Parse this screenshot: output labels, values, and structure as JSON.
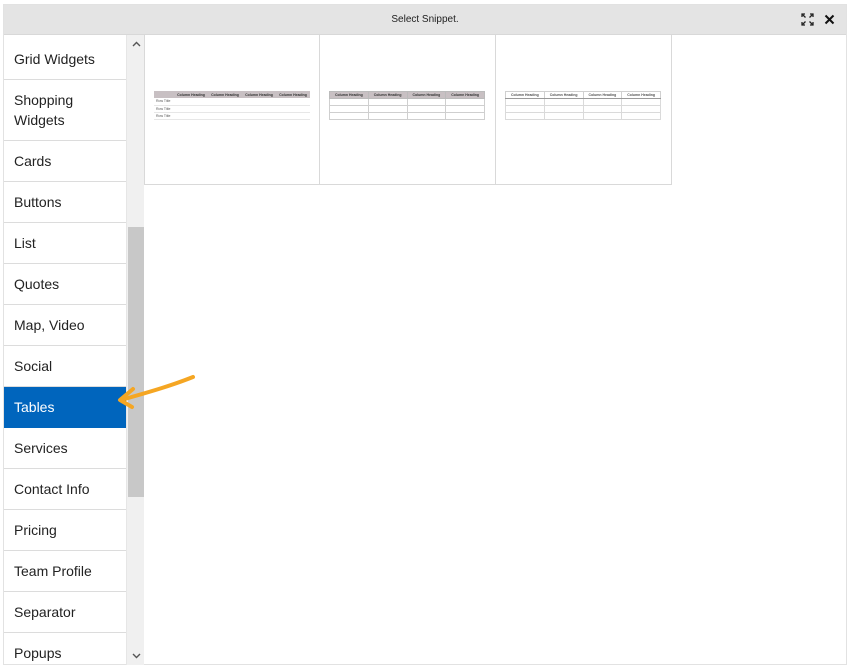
{
  "window": {
    "title": "Select Snippet."
  },
  "controls": {
    "maximize_icon": "expand-icon",
    "close_icon": "close-icon"
  },
  "sidebar": {
    "items": [
      {
        "label": "Grid Widgets"
      },
      {
        "label": "Shopping Widgets"
      },
      {
        "label": "Cards"
      },
      {
        "label": "Buttons"
      },
      {
        "label": "List"
      },
      {
        "label": "Quotes"
      },
      {
        "label": "Map, Video"
      },
      {
        "label": "Social"
      },
      {
        "label": "Tables"
      },
      {
        "label": "Services"
      },
      {
        "label": "Contact Info"
      },
      {
        "label": "Pricing"
      },
      {
        "label": "Team Profile"
      },
      {
        "label": "Separator"
      },
      {
        "label": "Popups"
      }
    ],
    "active": "Tables"
  },
  "snippets": {
    "header": "Column Heading",
    "row_title": "Row Title"
  },
  "colors": {
    "accent": "#0065bd",
    "arrow": "#f5a623"
  }
}
